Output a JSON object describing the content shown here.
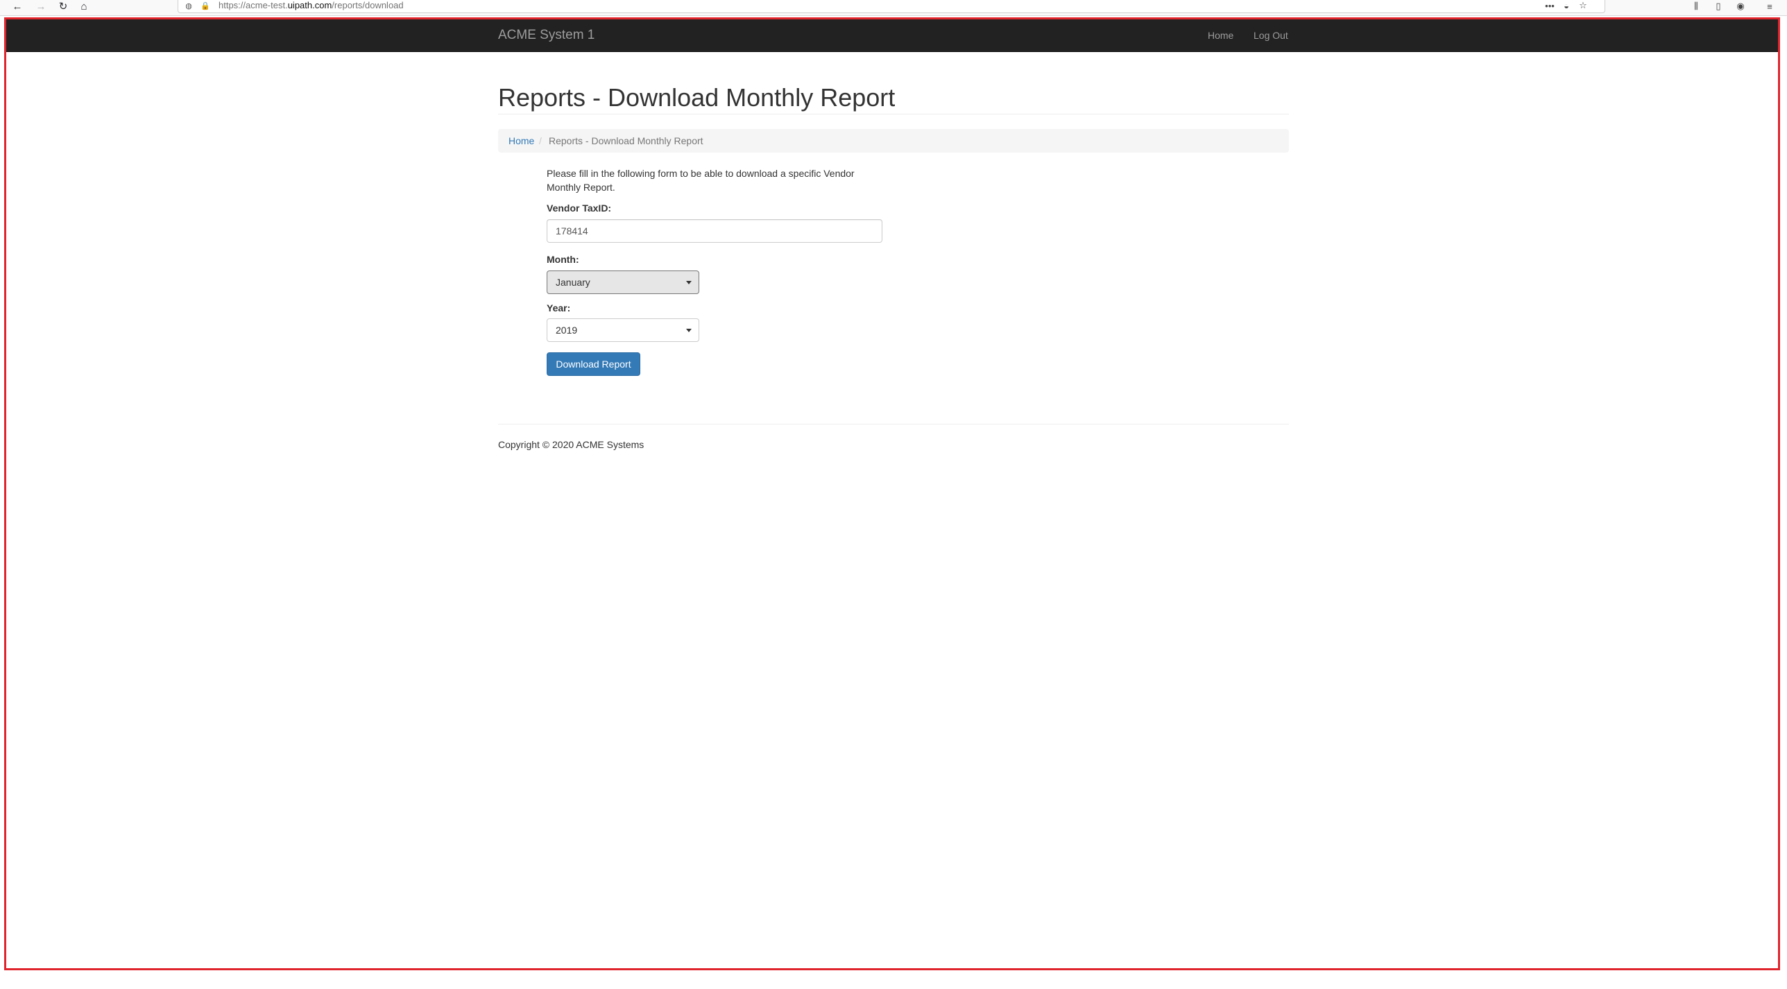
{
  "browser": {
    "url_prefix": "https://acme-test.",
    "url_domain": "uipath.com",
    "url_path": "/reports/download",
    "icons": {
      "back": "arrow-left-icon",
      "forward": "arrow-right-icon",
      "reload": "reload-icon",
      "home": "home-icon",
      "tracking": "shield-icon",
      "secure": "lock-icon",
      "more": "ellipsis-icon",
      "pocket": "pocket-icon",
      "bookmark": "star-icon",
      "library": "library-icon",
      "sidebar": "sidebar-icon",
      "account": "account-icon",
      "menu": "hamburger-icon"
    },
    "glyphs": {
      "back": "←",
      "forward": "→",
      "reload": "↻",
      "home": "⌂",
      "tracking": "◍",
      "secure": "🔒",
      "more": "•••",
      "pocket": "◒",
      "bookmark": "☆",
      "library": "⫼",
      "sidebar": "▯",
      "account": "◉",
      "menu": "≡"
    }
  },
  "navbar": {
    "brand": "ACME System 1",
    "links": [
      "Home",
      "Log Out"
    ]
  },
  "page": {
    "title": "Reports - Download Monthly Report",
    "breadcrumb": {
      "home": "Home",
      "separator": "/",
      "current": "Reports - Download Monthly Report"
    },
    "intro": "Please fill in the following form to be able to download a specific Vendor Monthly Report.",
    "form": {
      "vendor_label": "Vendor TaxID:",
      "vendor_value": "178414",
      "month_label": "Month:",
      "month_value": "January",
      "year_label": "Year:",
      "year_value": "2019",
      "submit_label": "Download Report"
    },
    "footer": "Copyright © 2020 ACME Systems"
  },
  "colors": {
    "navbar_bg": "#222222",
    "navbar_text": "#9d9d9d",
    "link": "#337ab7",
    "primary_button": "#337ab7",
    "frame_outline": "#e0242c"
  }
}
